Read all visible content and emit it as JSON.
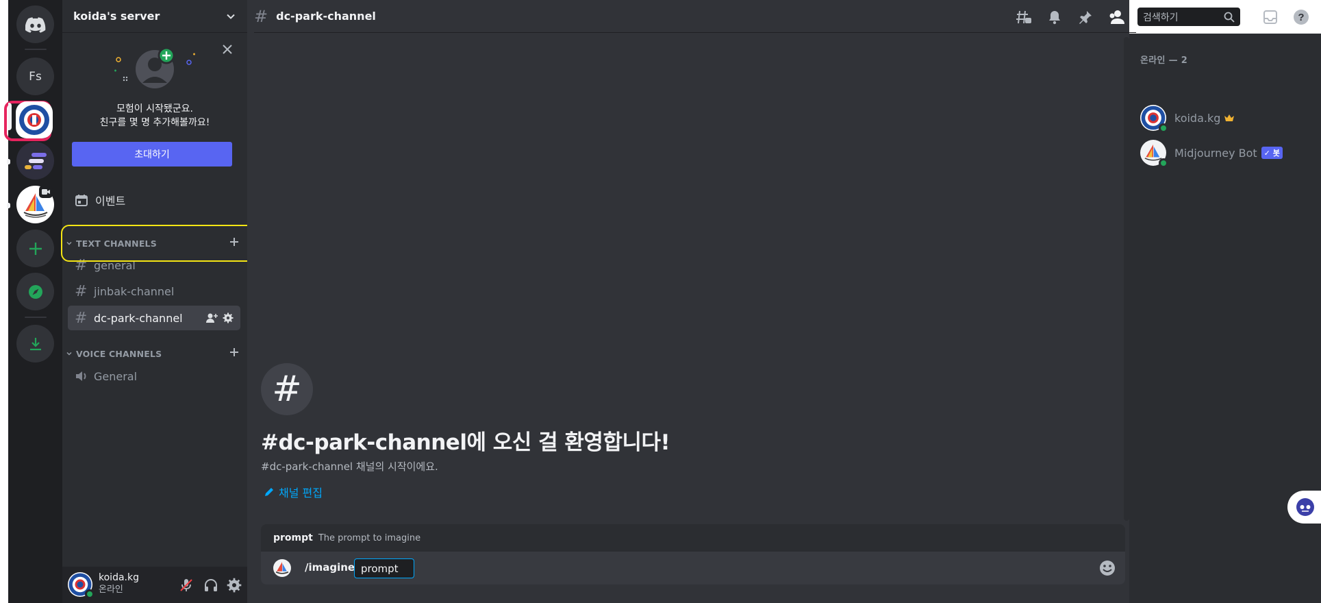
{
  "server": {
    "name": "koida's server"
  },
  "rail": {
    "fs_label": "Fs"
  },
  "invite_card": {
    "line1": "모험이 시작됐군요.",
    "line2": "친구를 몇 명 추가해볼까요!",
    "button": "초대하기"
  },
  "events": {
    "label": "이벤트"
  },
  "categories": {
    "text": "TEXT CHANNELS",
    "voice": "VOICE CHANNELS"
  },
  "channels": [
    {
      "name": "general"
    },
    {
      "name": "jinbak-channel"
    },
    {
      "name": "dc-park-channel"
    }
  ],
  "voice_channels": [
    {
      "name": "General"
    }
  ],
  "user": {
    "name": "koida.kg",
    "status": "온라인"
  },
  "header": {
    "channel": "dc-park-channel",
    "search_placeholder": "검색하기"
  },
  "welcome": {
    "title": "#dc-park-channel에 오신 걸 환영합니다!",
    "subtitle": "#dc-park-channel 채널의 시작이에요.",
    "edit": "채널 편집"
  },
  "composer": {
    "hint_name": "prompt",
    "hint_desc": "The prompt to imagine",
    "command": "/imagine",
    "param": "prompt"
  },
  "member_list": {
    "header": "온라인 — 2",
    "members": [
      {
        "name": "koida.kg"
      },
      {
        "name": "Midjourney Bot",
        "badge": "✓ 봇"
      }
    ]
  },
  "colors": {
    "accent": "#5865f2",
    "online": "#23a55a",
    "highlight_red": "#e6245e",
    "highlight_yellow": "#f5e614",
    "link": "#00a8fc"
  }
}
